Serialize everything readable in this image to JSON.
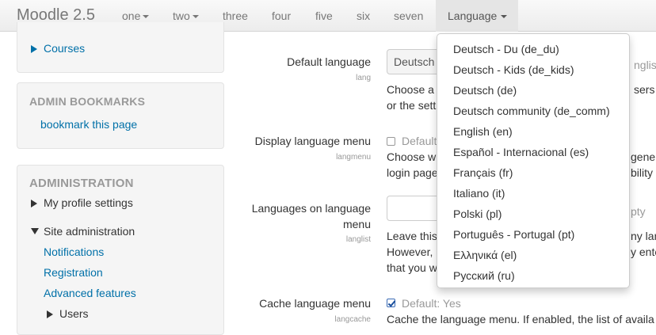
{
  "navbar": {
    "brand": "Moodle 2.5",
    "items": [
      "one",
      "two",
      "three",
      "four",
      "five",
      "six",
      "seven"
    ],
    "language_label": "Language"
  },
  "language_menu": [
    "Deutsch - Du (de_du)",
    "Deutsch - Kids (de_kids)",
    "Deutsch (de)",
    "Deutsch community (de_comm)",
    "English (en)",
    "Español - Internacional (es)",
    "Français (fr)",
    "Italiano (it)",
    "Polski (pl)",
    "Português - Portugal (pt)",
    "Ελληνικά (el)",
    "Русский (ru)"
  ],
  "sidebar": {
    "courses_link": "Courses",
    "bookmarks_title": "ADMIN BOOKMARKS",
    "bookmark_link": "bookmark this page",
    "admin_title": "ADMINISTRATION",
    "my_profile": "My profile settings",
    "site_admin": "Site administration",
    "admin_links": [
      "Notifications",
      "Registration",
      "Advanced features"
    ],
    "users": "Users"
  },
  "settings": {
    "default_language": {
      "label": "Default language",
      "name": "lang",
      "value": "Deutsch",
      "right_hint": "nglish",
      "desc_line1": "Choose a",
      "desc_line1_right": "sers c",
      "desc_line2": "or the sett"
    },
    "display_menu": {
      "label": "Display language menu",
      "name": "langmenu",
      "checkbox_label": "Default",
      "desc_line1": "Choose w",
      "desc_line1_right": "genera",
      "desc_line2": "login page",
      "desc_line2_right": "bility t"
    },
    "languages_menu": {
      "label_line1": "Languages on language",
      "label_line2": "menu",
      "name": "langlist",
      "right_hint": "pty",
      "desc_line1": "Leave this",
      "desc_line1_right": "ny lan",
      "desc_line2": "However,",
      "desc_line2_right": "y ente",
      "desc_line3": "that you w"
    },
    "cache_menu": {
      "label": "Cache language menu",
      "name": "langcache",
      "checkbox_label": "Default: Yes",
      "desc": "Cache the language menu. If enabled, the list of availa"
    }
  }
}
